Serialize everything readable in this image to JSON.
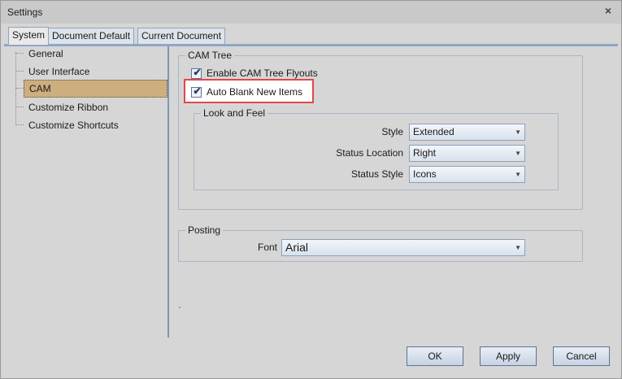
{
  "window": {
    "title": "Settings",
    "close_symbol": "×"
  },
  "tabs": [
    {
      "label": "System",
      "active": true
    },
    {
      "label": "Document Default",
      "active": false
    },
    {
      "label": "Current Document",
      "active": false
    }
  ],
  "nav": {
    "items": [
      {
        "label": "General",
        "selected": false
      },
      {
        "label": "User Interface",
        "selected": false
      },
      {
        "label": "CAM",
        "selected": true
      },
      {
        "label": "Customize Ribbon",
        "selected": false
      },
      {
        "label": "Customize Shortcuts",
        "selected": false
      }
    ]
  },
  "cam_tree": {
    "title": "CAM Tree",
    "enable_flyouts": {
      "label": "Enable CAM Tree Flyouts",
      "checked": true
    },
    "auto_blank": {
      "label": "Auto Blank New Items",
      "checked": true
    },
    "check_symbol": "✔",
    "look_and_feel": {
      "title": "Look and Feel",
      "style": {
        "label": "Style",
        "value": "Extended"
      },
      "status_location": {
        "label": "Status Location",
        "value": "Right"
      },
      "status_style": {
        "label": "Status Style",
        "value": "Icons"
      }
    }
  },
  "posting": {
    "title": "Posting",
    "font": {
      "label": "Font",
      "value": "Arial"
    }
  },
  "dropdown_arrow": "▼",
  "buttons": {
    "ok": "OK",
    "apply": "Apply",
    "cancel": "Cancel"
  },
  "colors": {
    "selection": "#cdae7e",
    "highlight": "#e0474c",
    "accent": "#8ea7c7"
  }
}
